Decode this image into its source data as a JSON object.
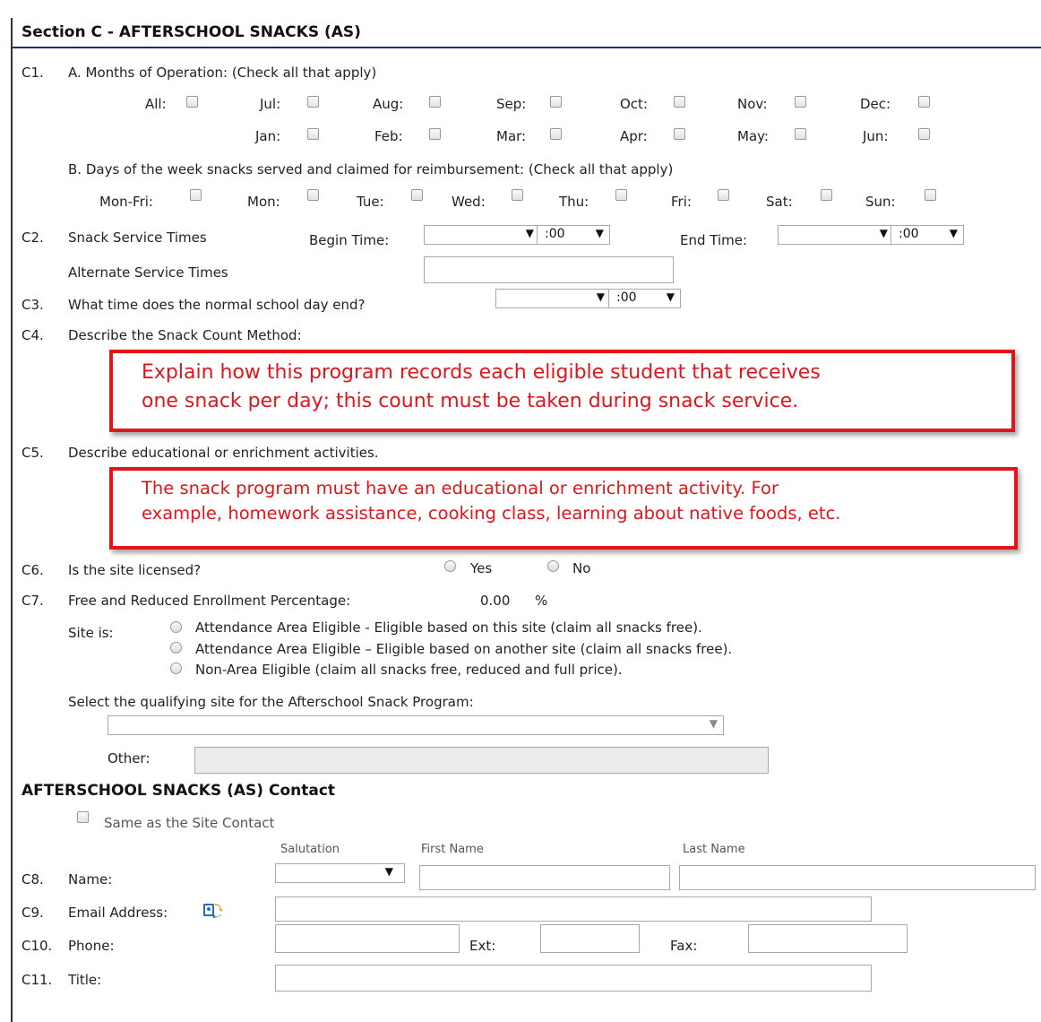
{
  "section": {
    "title": "Section C - AFTERSCHOOL SNACKS (AS)"
  },
  "c1": {
    "num": "C1.",
    "a_label": "A. Months of Operation: (Check all that apply)",
    "months_row1": [
      "All:",
      "Jul:",
      "Aug:",
      "Sep:",
      "Oct:",
      "Nov:",
      "Dec:"
    ],
    "months_row2": [
      "Jan:",
      "Feb:",
      "Mar:",
      "Apr:",
      "May:",
      "Jun:"
    ],
    "b_label": "B. Days of the week snacks served and claimed for reimbursement: (Check all that apply)",
    "days": [
      "Mon-Fri:",
      "Mon:",
      "Tue:",
      "Wed:",
      "Thu:",
      "Fri:",
      "Sat:",
      "Sun:"
    ]
  },
  "c2": {
    "num": "C2.",
    "label": "Snack Service Times",
    "begin_label": "Begin Time:",
    "end_label": "End Time:",
    "minutes": ":00",
    "alt_label": "Alternate Service Times"
  },
  "c3": {
    "num": "C3.",
    "label": "What time does the normal school day end?",
    "minutes": ":00"
  },
  "c4": {
    "num": "C4.",
    "label": "Describe the Snack Count Method:",
    "callout_line1": "Explain how this program records each eligible student that receives",
    "callout_line2": "one snack per day; this count must be taken during snack service."
  },
  "c5": {
    "num": "C5.",
    "label": "Describe educational or enrichment activities.",
    "callout_line1": "The snack program must have an educational or enrichment activity. For",
    "callout_line2": "example, homework assistance, cooking class, learning about native foods, etc."
  },
  "c6": {
    "num": "C6.",
    "label": "Is the site licensed?",
    "yes": "Yes",
    "no": "No"
  },
  "c7": {
    "num": "C7.",
    "label": "Free and Reduced Enrollment Percentage:",
    "value": "0.00",
    "unit": "%",
    "site_is": "Site is:",
    "options": [
      "Attendance Area Eligible - Eligible based on this site (claim all snacks free).",
      "Attendance Area Eligible – Eligible based on another site (claim all snacks free).",
      "Non-Area Eligible (claim all snacks free, reduced and full price)."
    ],
    "qualifying_label": "Select the qualifying site for the Afterschool Snack Program:",
    "other_label": "Other:"
  },
  "contact": {
    "title": "AFTERSCHOOL SNACKS (AS) Contact",
    "same_as": "Same as the Site Contact",
    "salutation": "Salutation",
    "first_name": "First Name",
    "last_name": "Last Name",
    "c8_num": "C8.",
    "c8_label": "Name:",
    "c9_num": "C9.",
    "c9_label": "Email Address:",
    "c10_num": "C10.",
    "c10_label": "Phone:",
    "ext_label": "Ext:",
    "fax_label": "Fax:",
    "c11_num": "C11.",
    "c11_label": "Title:"
  },
  "colors": {
    "accent_red": "#e0161c",
    "section_rule": "#1f2f6b"
  },
  "icons": {
    "email_lookup": "address-book-refresh-icon"
  }
}
